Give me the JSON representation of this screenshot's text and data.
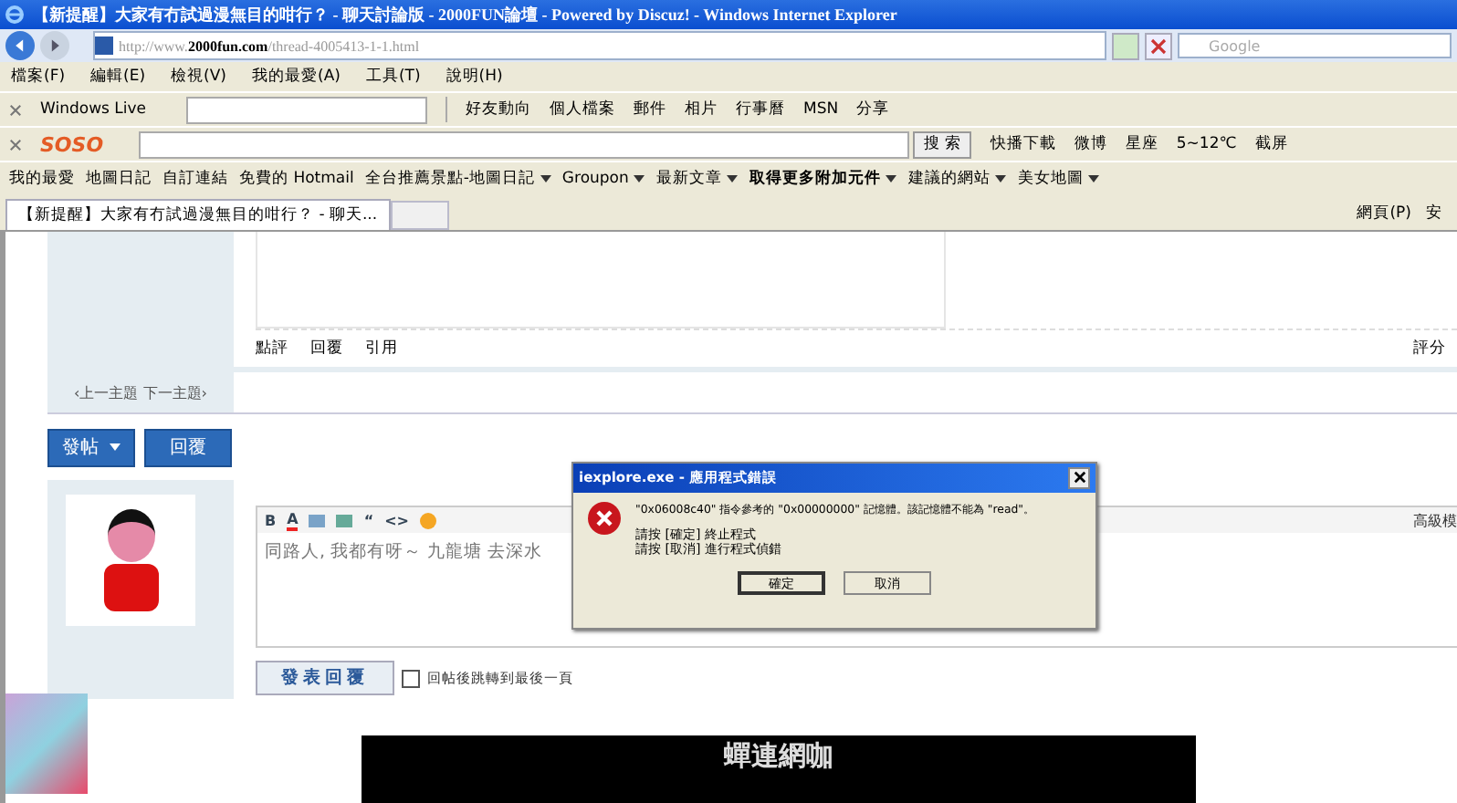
{
  "window": {
    "title": "【新提醒】大家有冇試過漫無目的咁行？ - 聊天討論版 - 2000FUN論壇 - Powered by Discuz! - Windows Internet Explorer"
  },
  "address_bar": {
    "url_prefix": "http://www.",
    "url_host": "2000fun.com",
    "url_path": "/thread-4005413-1-1.html",
    "search_placeholder": "Google"
  },
  "menu": [
    "檔案(F)",
    "編輯(E)",
    "檢視(V)",
    "我的最愛(A)",
    "工具(T)",
    "說明(H)"
  ],
  "windows_live_bar": {
    "label": "Windows Live",
    "links": [
      "好友動向",
      "個人檔案",
      "郵件",
      "相片",
      "行事曆",
      "MSN",
      "分享"
    ]
  },
  "soso_bar": {
    "logo": "SOSO",
    "search_button": "搜 索",
    "items": [
      "快播下載",
      "微博",
      "星座",
      "5~12℃",
      "截屏"
    ]
  },
  "favorites_bar": {
    "label": "我的最愛",
    "items": [
      {
        "label": "地圖日記",
        "dropdown": false,
        "bold": false
      },
      {
        "label": "自訂連結",
        "dropdown": false,
        "bold": false
      },
      {
        "label": "免費的 Hotmail",
        "dropdown": false,
        "bold": false
      },
      {
        "label": "全台推薦景點-地圖日記",
        "dropdown": true,
        "bold": false
      },
      {
        "label": "Groupon",
        "dropdown": true,
        "bold": false
      },
      {
        "label": "最新文章",
        "dropdown": true,
        "bold": false
      },
      {
        "label": "取得更多附加元件",
        "dropdown": true,
        "bold": true
      },
      {
        "label": "建議的網站",
        "dropdown": true,
        "bold": false
      },
      {
        "label": "美女地圖",
        "dropdown": true,
        "bold": false
      }
    ]
  },
  "tabs": [
    {
      "label": "【新提醒】大家有冇試過漫無目的咁行？ - 聊天...",
      "selected": true
    }
  ],
  "command_bar": {
    "page_menu": "網頁(P)",
    "cut_item": "安"
  },
  "post": {
    "actions": [
      "點評",
      "回覆",
      "引用"
    ],
    "rate": "評分",
    "prev_next": "‹上一主題  下一主題›"
  },
  "buttons": [
    "發帖",
    "回覆"
  ],
  "editor_tools": [
    {
      "kind": "bold",
      "label": "B"
    },
    {
      "kind": "color",
      "label": "A"
    },
    {
      "kind": "image"
    },
    {
      "kind": "link"
    },
    {
      "kind": "text",
      "label": "“"
    },
    {
      "kind": "text",
      "label": "<>"
    },
    {
      "kind": "smiley"
    }
  ],
  "reply": {
    "value": "同路人, 我都有呀～  九龍塘  去深水",
    "advanced": "高級模",
    "submit": "發表回覆",
    "checkbox_label": "回帖後跳轉到最後一頁",
    "checked": false
  },
  "banner": {
    "text": "蟬連網咖"
  },
  "dialog": {
    "title": "iexplore.exe - 應用程式錯誤",
    "message": "\"0x06008c40\" 指令參考的 \"0x00000000\" 記憶體。該記憶體不能為 \"read\"。",
    "lines": [
      "請按 [確定] 終止程式",
      "請按 [取消] 進行程式偵錯"
    ],
    "buttons": [
      {
        "label": "確定",
        "selected": true
      },
      {
        "label": "取消",
        "selected": false
      }
    ]
  }
}
